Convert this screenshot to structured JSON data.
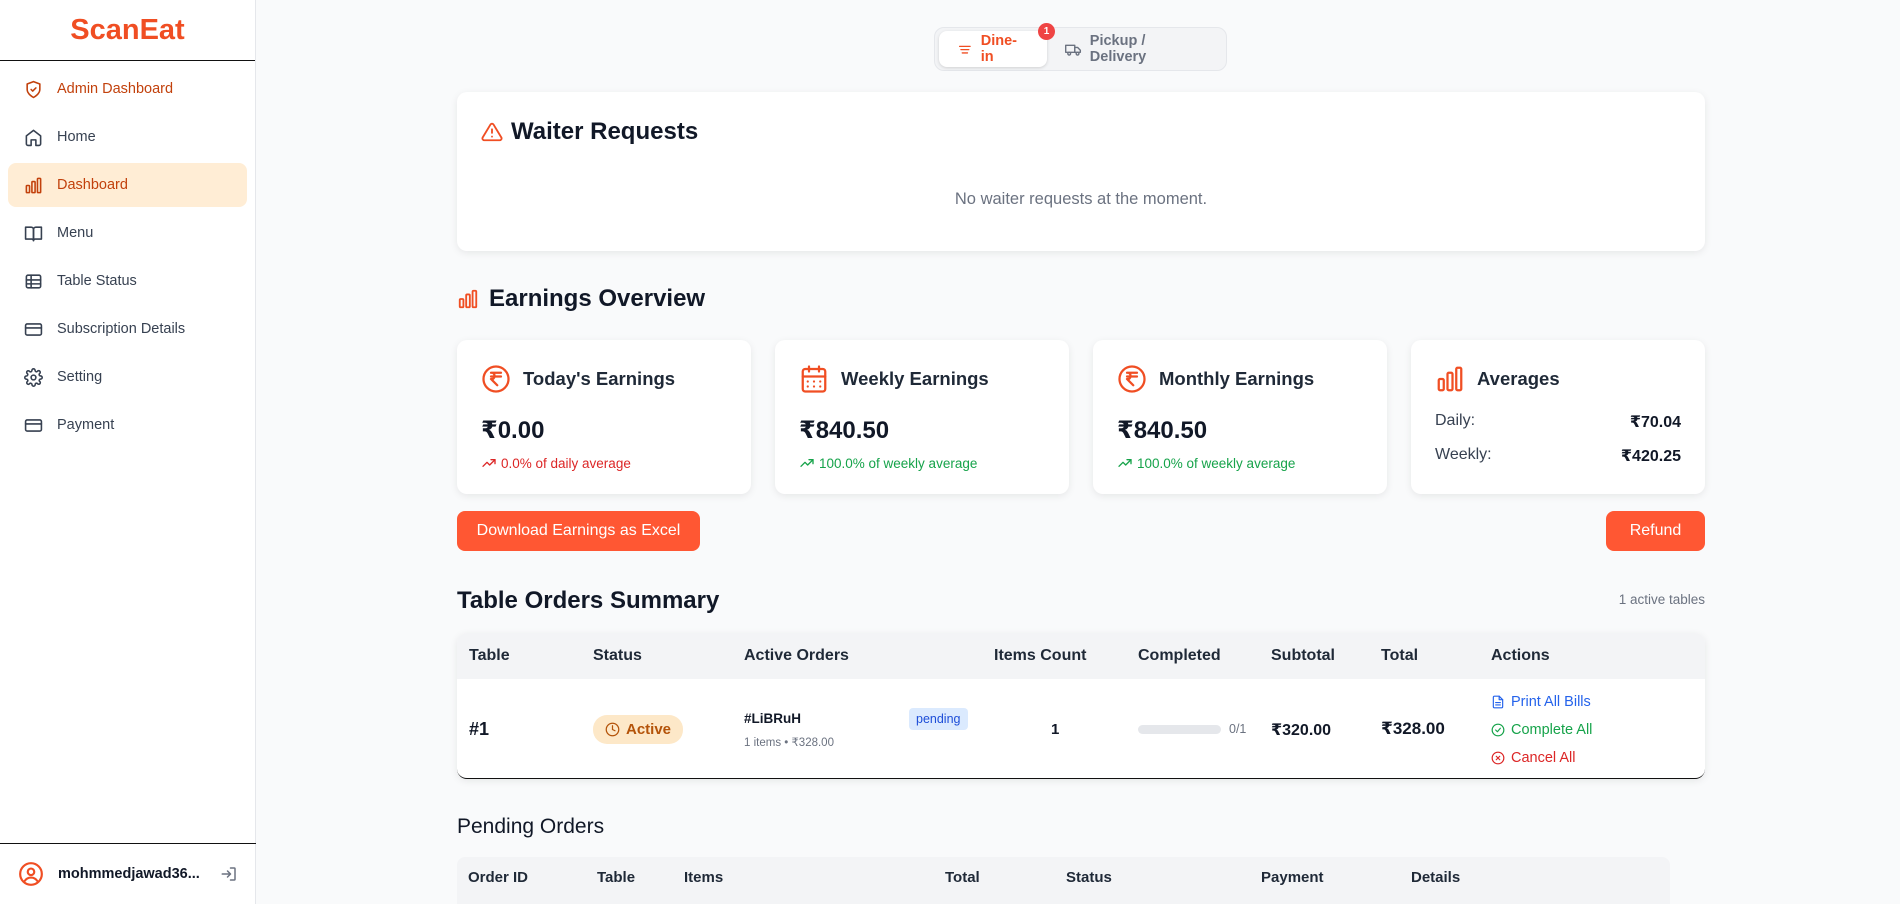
{
  "app": {
    "brand": "ScanEat"
  },
  "sidebar": {
    "items": [
      {
        "label": "Admin Dashboard",
        "icon": "shield-icon"
      },
      {
        "label": "Home",
        "icon": "home-icon"
      },
      {
        "label": "Dashboard",
        "icon": "bar-chart-icon",
        "active": true
      },
      {
        "label": "Menu",
        "icon": "book-icon"
      },
      {
        "label": "Table Status",
        "icon": "table-icon"
      },
      {
        "label": "Subscription Details",
        "icon": "card-icon"
      },
      {
        "label": "Setting",
        "icon": "gear-icon"
      },
      {
        "label": "Payment",
        "icon": "card-icon"
      }
    ],
    "user": {
      "name": "mohmmedjawad36..."
    }
  },
  "mode_toggle": {
    "dine_in": "Dine-in",
    "dine_in_badge": "1",
    "pickup": "Pickup / Delivery"
  },
  "waiter_requests": {
    "title": "Waiter Requests",
    "empty_message": "No waiter requests at the moment."
  },
  "earnings": {
    "title": "Earnings Overview",
    "today": {
      "label": "Today's Earnings",
      "value": "₹0.00",
      "change": "0.0% of daily average"
    },
    "weekly": {
      "label": "Weekly Earnings",
      "value": "₹840.50",
      "change": "100.0% of weekly average"
    },
    "monthly": {
      "label": "Monthly Earnings",
      "value": "₹840.50",
      "change": "100.0% of weekly average"
    },
    "averages": {
      "label": "Averages",
      "daily_label": "Daily:",
      "daily_value": "₹70.04",
      "weekly_label": "Weekly:",
      "weekly_value": "₹420.25"
    },
    "download_label": "Download Earnings as Excel",
    "refund_label": "Refund"
  },
  "table_orders": {
    "title": "Table Orders Summary",
    "active_count": "1 active tables",
    "columns": [
      "Table",
      "Status",
      "Active Orders",
      "Items Count",
      "Completed",
      "Subtotal",
      "Total",
      "Actions"
    ],
    "rows": [
      {
        "table": "#1",
        "status": "Active",
        "order_id": "#LiBRuH",
        "order_meta": "1 items • ₹328.00",
        "order_status": "pending",
        "items_count": "1",
        "completed": "0/1",
        "completed_fraction": 0,
        "subtotal": "₹320.00",
        "total": "₹328.00",
        "actions": {
          "print": "Print All Bills",
          "complete": "Complete All",
          "cancel": "Cancel All"
        }
      }
    ]
  },
  "pending_orders": {
    "title": "Pending Orders",
    "columns": [
      "Order ID",
      "Table",
      "Items",
      "Total",
      "Status",
      "Payment",
      "Details"
    ]
  },
  "colors": {
    "accent": "#f04e23",
    "button": "#ff5733",
    "active_bg": "#ffedd5",
    "success": "#16a34a",
    "danger": "#dc2626",
    "info": "#2563eb"
  }
}
